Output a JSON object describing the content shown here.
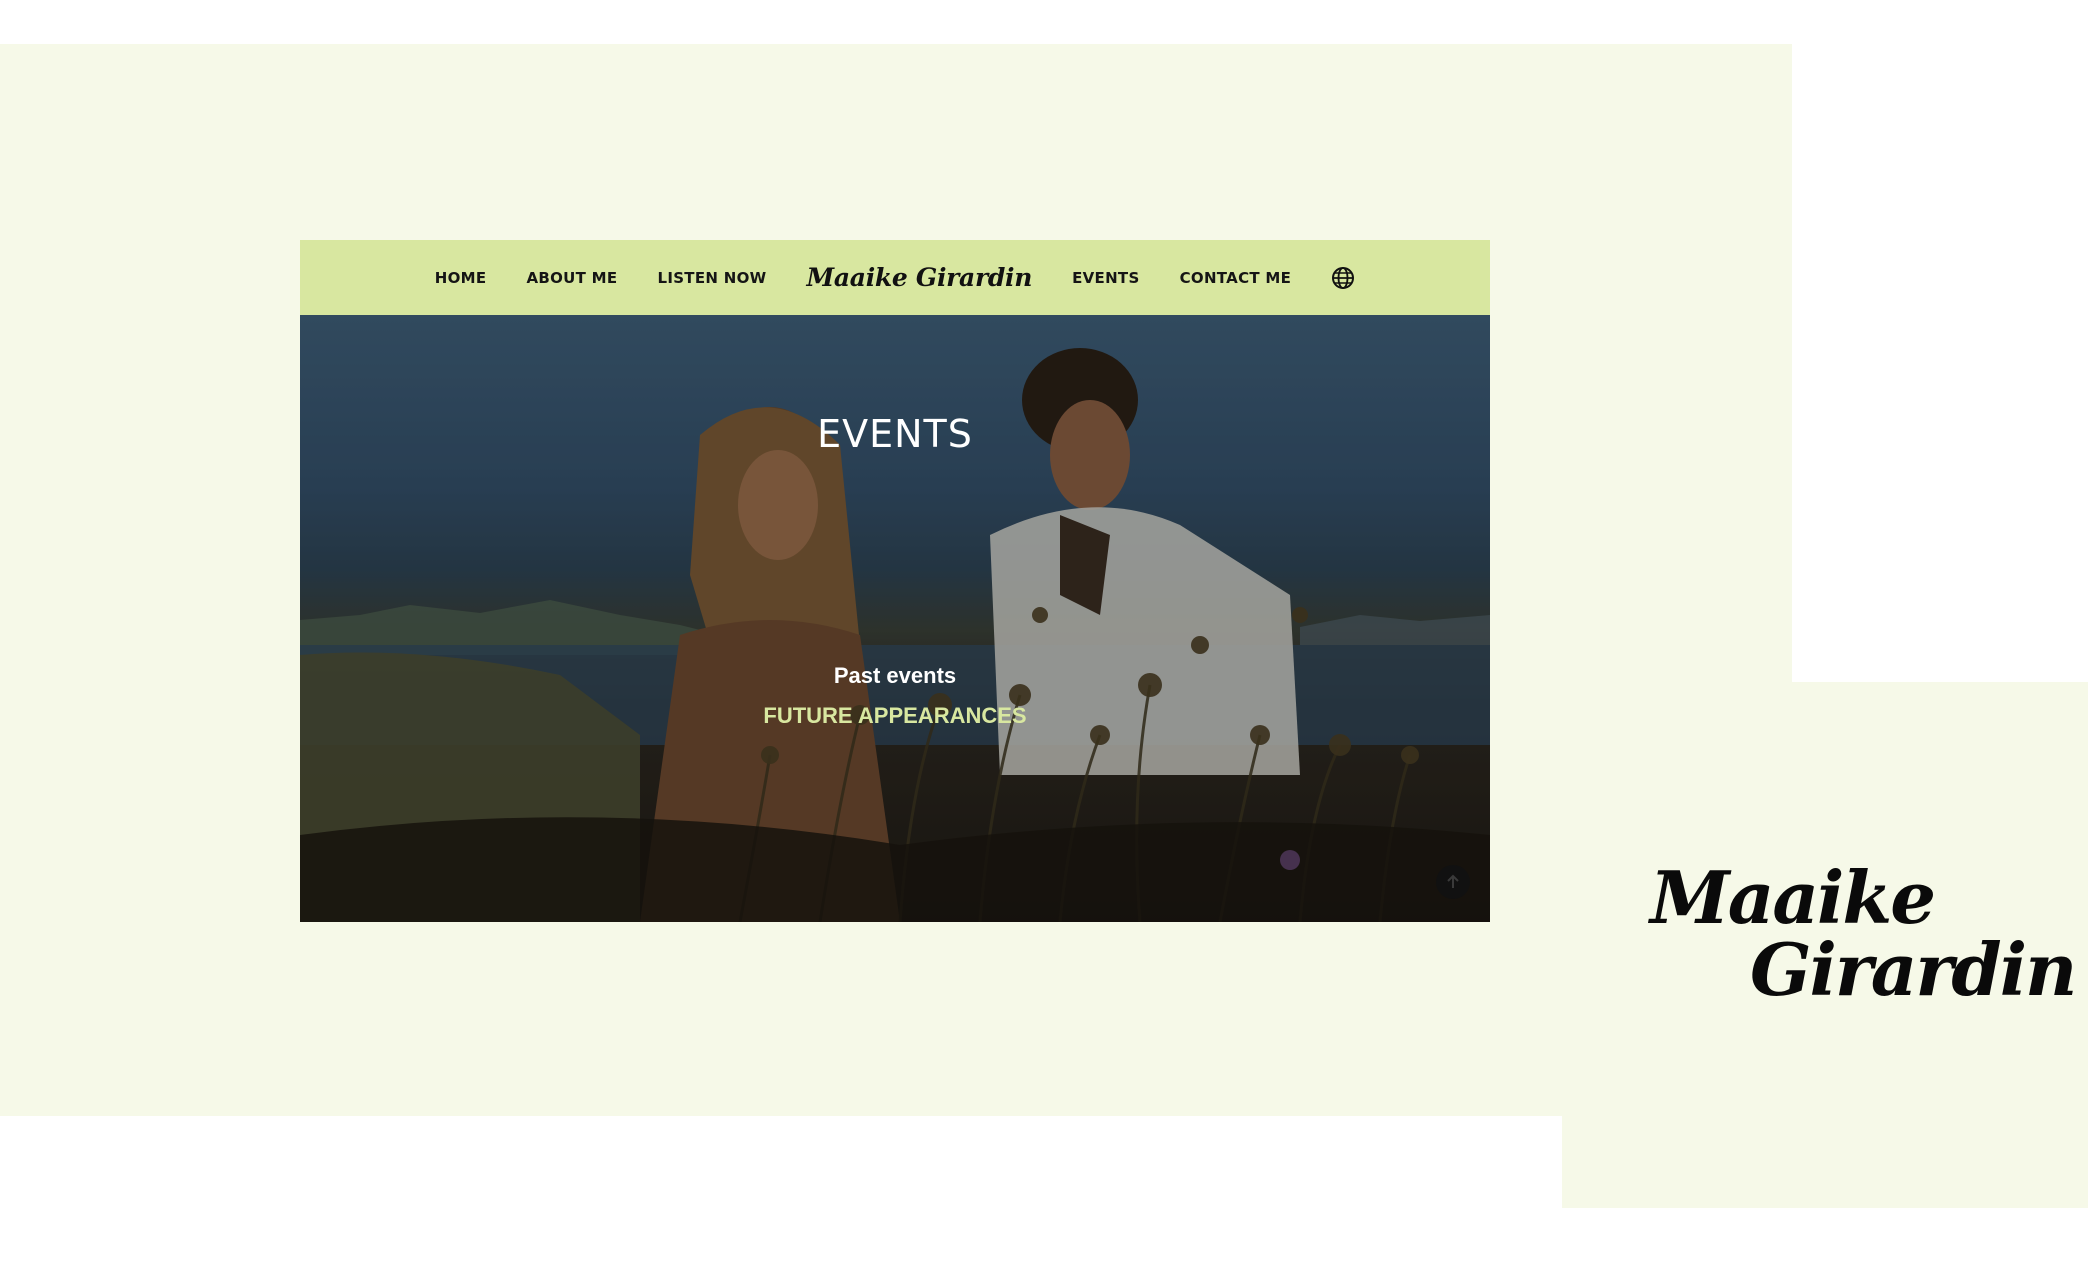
{
  "nav": {
    "home": "HOME",
    "about": "ABOUT ME",
    "listen": "LISTEN NOW",
    "brand": "Maaike Girardin",
    "events": "EVENTS",
    "contact": "CONTACT ME",
    "language_icon": "globe-icon"
  },
  "hero": {
    "title": "EVENTS",
    "past_link": "Past events",
    "future_link": "FUTURE APPEARANCES",
    "scroll_top_icon": "arrow-up-icon"
  },
  "logo": {
    "line1": "Maaike",
    "line2": "Girardin"
  },
  "colors": {
    "nav_bg": "#d8e7a0",
    "page_bg": "#f6f9e8",
    "accent": "#d8e7a0"
  }
}
